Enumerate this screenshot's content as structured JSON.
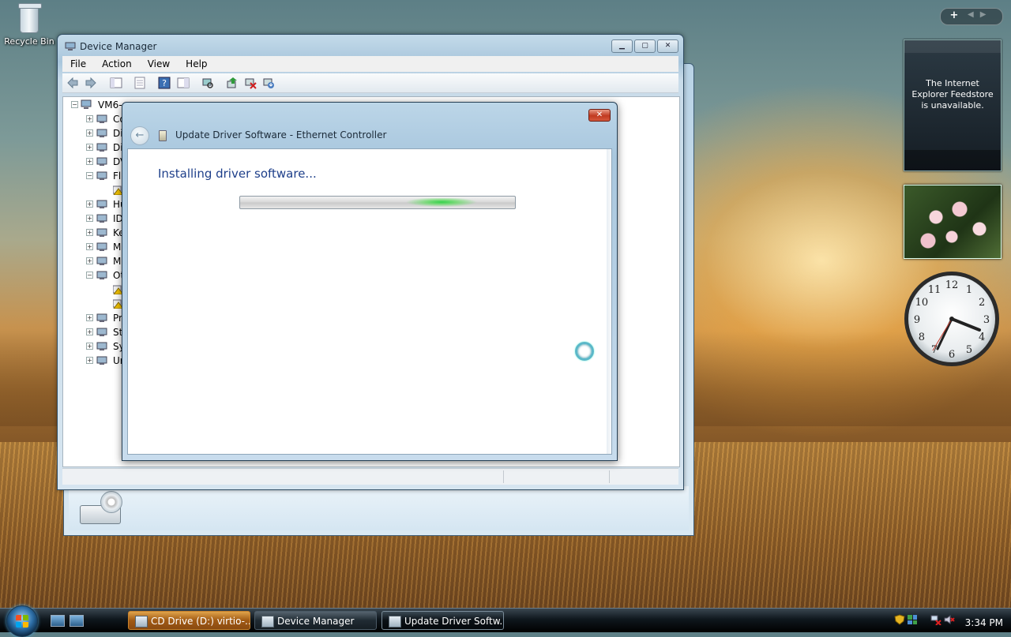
{
  "desktop": {
    "recycle_bin_label": "Recycle Bin",
    "feed_gadget_message": "The Internet Explorer Feedstore is unavailable."
  },
  "cd_window": {},
  "device_manager": {
    "title": "Device Manager",
    "menu": [
      "File",
      "Action",
      "View",
      "Help"
    ],
    "tree": {
      "root_label": "VM6-",
      "items": [
        {
          "label": "Co",
          "expander": "+"
        },
        {
          "label": "Di",
          "expander": "+"
        },
        {
          "label": "Di",
          "expander": "+"
        },
        {
          "label": "DV",
          "expander": "+"
        },
        {
          "label": "Fl",
          "expander": "-"
        },
        {
          "label": "",
          "expander": ""
        },
        {
          "label": "Hu",
          "expander": "+"
        },
        {
          "label": "ID",
          "expander": "+"
        },
        {
          "label": "Ke",
          "expander": "+"
        },
        {
          "label": "M",
          "expander": "+"
        },
        {
          "label": "M",
          "expander": "+"
        },
        {
          "label": "Ot",
          "expander": "-"
        },
        {
          "label": "",
          "expander": ""
        },
        {
          "label": "",
          "expander": ""
        },
        {
          "label": "Pr",
          "expander": "+"
        },
        {
          "label": "St",
          "expander": "+"
        },
        {
          "label": "Sy",
          "expander": "+"
        },
        {
          "label": "Ur",
          "expander": "+"
        }
      ]
    }
  },
  "update_dialog": {
    "title": "Update Driver Software - Ethernet Controller",
    "heading": "Installing driver software...",
    "close_symbol": "✕",
    "back_symbol": "←"
  },
  "taskbar": {
    "tasks": [
      {
        "label": "CD Drive (D:) virtio-...",
        "state": "flashing"
      },
      {
        "label": "Device Manager",
        "state": "normal"
      },
      {
        "label": "Update Driver Softw...",
        "state": "active"
      }
    ],
    "clock": "3:34 PM"
  },
  "sidebar": {
    "add_symbol": "+",
    "clock_numerals": [
      "12",
      "1",
      "2",
      "3",
      "4",
      "5",
      "6",
      "7",
      "8",
      "9",
      "10",
      "11"
    ]
  }
}
